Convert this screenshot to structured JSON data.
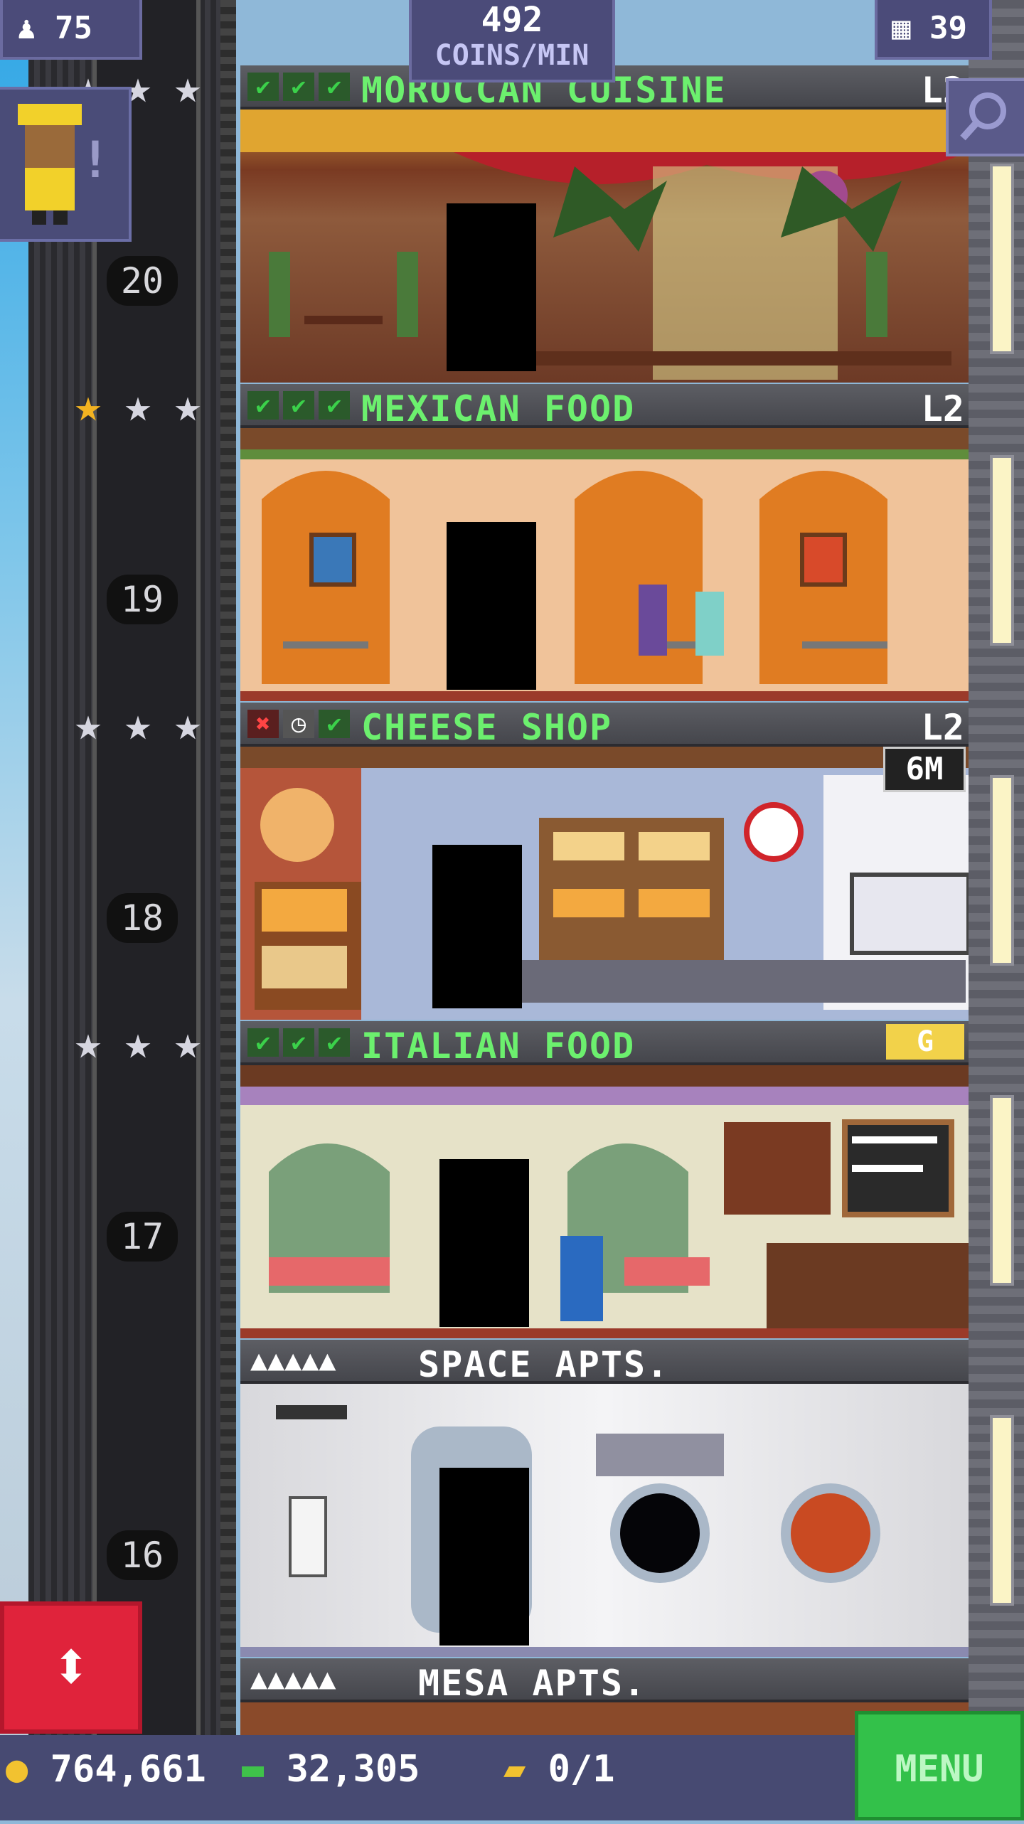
{
  "hud": {
    "population": "75",
    "coins_per_min_value": "492",
    "coins_per_min_label": "COINS/MIN",
    "floor_count": "39"
  },
  "floors": [
    {
      "name": "MOROCCAN CUISINE",
      "level": "L2",
      "floor_number": "20",
      "checks": [
        "check",
        "check",
        "check"
      ],
      "stars_gold": 0
    },
    {
      "name": "MEXICAN FOOD",
      "level": "L2",
      "floor_number": "19",
      "checks": [
        "check",
        "check",
        "check"
      ],
      "stars_gold": 1
    },
    {
      "name": "CHEESE SHOP",
      "level": "L2",
      "floor_number": "18",
      "checks": [
        "x",
        "clock",
        "check"
      ],
      "stars_gold": 0,
      "stock_timer": "6M"
    },
    {
      "name": "ITALIAN FOOD",
      "level": "",
      "floor_number": "17",
      "checks": [
        "check",
        "check",
        "check"
      ],
      "stars_gold": 0,
      "badge": "G"
    },
    {
      "name": "SPACE APTS.",
      "floor_number": "16",
      "residents": "▲▲▲▲▲"
    },
    {
      "name": "MESA APTS.",
      "residents": "▲▲▲▲▲"
    }
  ],
  "bottom": {
    "coins": "764,661",
    "bux": "32,305",
    "vip": "0/1",
    "menu_label": "MENU"
  },
  "colors": {
    "hud_bg": "#4b4b79",
    "floor_name": "#6cf06e",
    "menu_green": "#33c14a",
    "elevator_red": "#e0233b"
  }
}
